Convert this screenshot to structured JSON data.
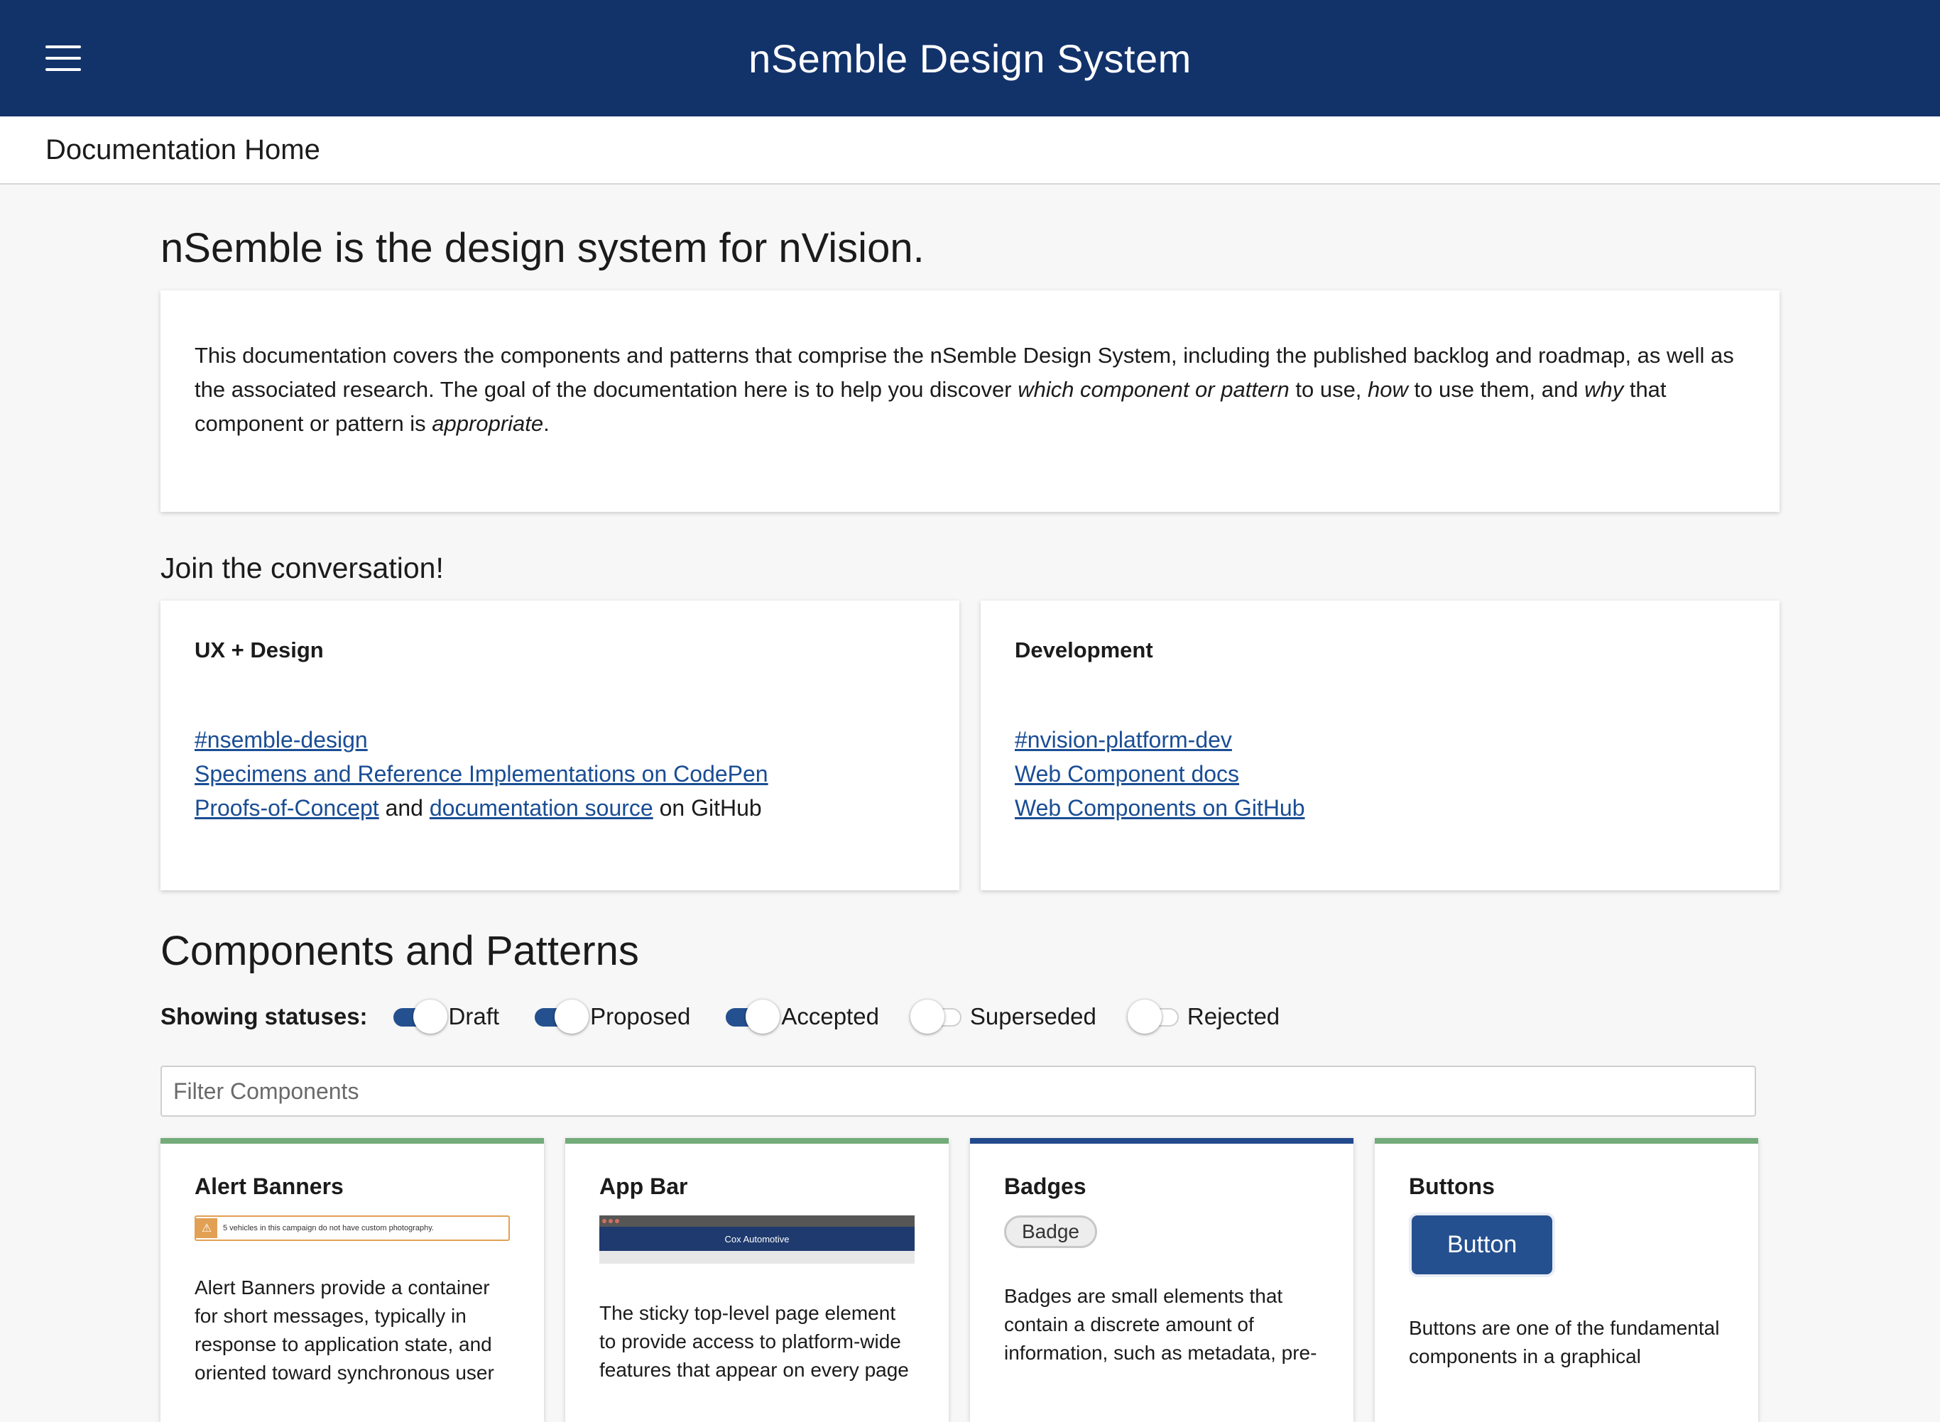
{
  "header": {
    "title": "nSemble Design System",
    "menu_icon": "hamburger-menu-icon"
  },
  "breadcrumb": {
    "label": "Documentation Home"
  },
  "intro": {
    "title": "nSemble is the design system for nVision.",
    "paragraph": {
      "part1": "This documentation covers the components and patterns that comprise the nSemble Design System, including the published backlog and roadmap, as well as the associated research. The goal of the documentation here is to help you discover ",
      "em1": "which component or pattern",
      "part2": " to use, ",
      "em2": "how",
      "part3": " to use them, and ",
      "em3": "why",
      "part4": " that component or pattern is ",
      "em4": "appropriate",
      "part5": "."
    }
  },
  "join": {
    "title": "Join the conversation!",
    "ux": {
      "title": "UX + Design",
      "link1": "#nsemble-design",
      "link2": "Specimens and Reference Implementations on CodePen",
      "link3a": "Proofs-of-Concept",
      "and": " and ",
      "link3b": "documentation source",
      "on_github": " on GitHub"
    },
    "dev": {
      "title": "Development",
      "link1": "#nvision-platform-dev",
      "link2": "Web Component docs",
      "link3": "Web Components on GitHub"
    }
  },
  "components": {
    "title": "Components and Patterns",
    "status_label": "Showing statuses:",
    "statuses": [
      {
        "label": "Draft",
        "on": true
      },
      {
        "label": "Proposed",
        "on": true
      },
      {
        "label": "Accepted",
        "on": true
      },
      {
        "label": "Superseded",
        "on": false
      },
      {
        "label": "Rejected",
        "on": false
      }
    ],
    "filter_placeholder": "Filter Components",
    "cards": [
      {
        "title": "Alert Banners",
        "preview_text": "5 vehicles in this campaign do not have custom photography.",
        "description": "Alert Banners provide a container for short messages, typically in response to application state, and oriented toward synchronous user",
        "status_color": "#74ab7a"
      },
      {
        "title": "App Bar",
        "preview_text": "Cox Automotive",
        "description": "The sticky top-level page element to provide access to platform-wide features that appear on every page",
        "status_color": "#74ab7a"
      },
      {
        "title": "Badges",
        "preview_text": "Badge",
        "description": "Badges are small elements that contain a discrete amount of information, such as metadata, pre-",
        "status_color": "#234a8c"
      },
      {
        "title": "Buttons",
        "preview_text": "Button",
        "description": "Buttons are one of the fundamental components in a graphical",
        "status_color": "#74ab7a"
      }
    ]
  }
}
